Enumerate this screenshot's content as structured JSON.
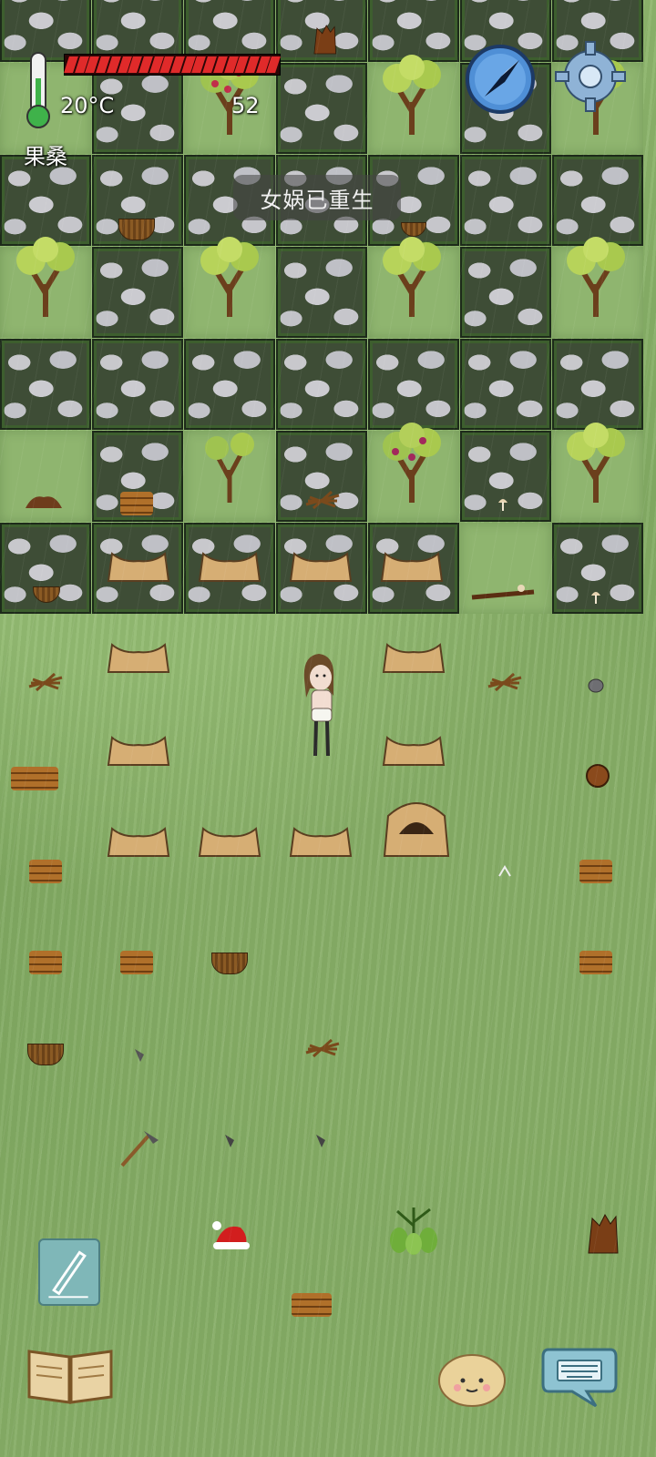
{
  "hud": {
    "temperature": "20°C",
    "object_name": "果桑",
    "age": "52",
    "food_pips_total": 20,
    "food_pips_filled": 20,
    "food_color": "#e02a2a",
    "notification": "女娲已重生"
  },
  "icons": {
    "thermometer": "thermometer-icon",
    "compass": "compass-icon",
    "settings": "gear-icon",
    "note": "pen-icon",
    "recipe_book": "book-icon",
    "emote": "emote-face-icon",
    "chat": "keyboard-chat-icon"
  }
}
